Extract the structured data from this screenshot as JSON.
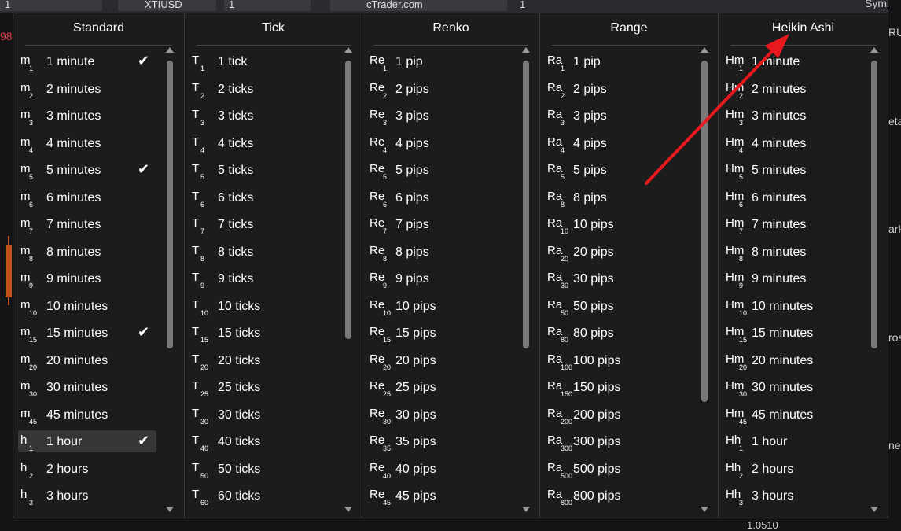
{
  "background": {
    "tabs": [
      "1",
      "XTIUSD",
      "1",
      "cTrader.com",
      "1"
    ],
    "symbol_label": "Symb",
    "right_fragments": [
      "RU",
      "eta",
      "ark",
      "ros",
      "ne"
    ],
    "left_fragment": "98",
    "price_label": "1.0510"
  },
  "colors": {
    "panel_bg": "#1c1c1c",
    "text": "#ffffff",
    "selected_row": "#363638",
    "arrow": "#e8191e",
    "candle": "#c0541e"
  },
  "columns": [
    {
      "title": "Standard",
      "rows": [
        {
          "abbr": "m",
          "sub": "1",
          "label": "1 minute",
          "checked": true
        },
        {
          "abbr": "m",
          "sub": "2",
          "label": "2 minutes",
          "checked": false
        },
        {
          "abbr": "m",
          "sub": "3",
          "label": "3 minutes",
          "checked": false
        },
        {
          "abbr": "m",
          "sub": "4",
          "label": "4 minutes",
          "checked": false
        },
        {
          "abbr": "m",
          "sub": "5",
          "label": "5 minutes",
          "checked": true
        },
        {
          "abbr": "m",
          "sub": "6",
          "label": "6 minutes",
          "checked": false
        },
        {
          "abbr": "m",
          "sub": "7",
          "label": "7 minutes",
          "checked": false
        },
        {
          "abbr": "m",
          "sub": "8",
          "label": "8 minutes",
          "checked": false
        },
        {
          "abbr": "m",
          "sub": "9",
          "label": "9 minutes",
          "checked": false
        },
        {
          "abbr": "m",
          "sub": "10",
          "label": "10 minutes",
          "checked": false
        },
        {
          "abbr": "m",
          "sub": "15",
          "label": "15 minutes",
          "checked": true
        },
        {
          "abbr": "m",
          "sub": "20",
          "label": "20 minutes",
          "checked": false
        },
        {
          "abbr": "m",
          "sub": "30",
          "label": "30 minutes",
          "checked": false
        },
        {
          "abbr": "m",
          "sub": "45",
          "label": "45 minutes",
          "checked": false
        },
        {
          "abbr": "h",
          "sub": "1",
          "label": "1 hour",
          "checked": true,
          "selected": true
        },
        {
          "abbr": "h",
          "sub": "2",
          "label": "2 hours",
          "checked": false
        },
        {
          "abbr": "h",
          "sub": "3",
          "label": "3 hours",
          "checked": false
        }
      ]
    },
    {
      "title": "Tick",
      "rows": [
        {
          "abbr": "T",
          "sub": "1",
          "label": "1 tick"
        },
        {
          "abbr": "T",
          "sub": "2",
          "label": "2 ticks"
        },
        {
          "abbr": "T",
          "sub": "3",
          "label": "3 ticks"
        },
        {
          "abbr": "T",
          "sub": "4",
          "label": "4 ticks"
        },
        {
          "abbr": "T",
          "sub": "5",
          "label": "5 ticks"
        },
        {
          "abbr": "T",
          "sub": "6",
          "label": "6 ticks"
        },
        {
          "abbr": "T",
          "sub": "7",
          "label": "7 ticks"
        },
        {
          "abbr": "T",
          "sub": "8",
          "label": "8 ticks"
        },
        {
          "abbr": "T",
          "sub": "9",
          "label": "9 ticks"
        },
        {
          "abbr": "T",
          "sub": "10",
          "label": "10 ticks"
        },
        {
          "abbr": "T",
          "sub": "15",
          "label": "15 ticks"
        },
        {
          "abbr": "T",
          "sub": "20",
          "label": "20 ticks"
        },
        {
          "abbr": "T",
          "sub": "25",
          "label": "25 ticks"
        },
        {
          "abbr": "T",
          "sub": "30",
          "label": "30 ticks"
        },
        {
          "abbr": "T",
          "sub": "40",
          "label": "40 ticks"
        },
        {
          "abbr": "T",
          "sub": "50",
          "label": "50 ticks"
        },
        {
          "abbr": "T",
          "sub": "60",
          "label": "60 ticks"
        }
      ]
    },
    {
      "title": "Renko",
      "rows": [
        {
          "abbr": "Re",
          "sub": "1",
          "label": "1 pip"
        },
        {
          "abbr": "Re",
          "sub": "2",
          "label": "2 pips"
        },
        {
          "abbr": "Re",
          "sub": "3",
          "label": "3 pips"
        },
        {
          "abbr": "Re",
          "sub": "4",
          "label": "4 pips"
        },
        {
          "abbr": "Re",
          "sub": "5",
          "label": "5 pips"
        },
        {
          "abbr": "Re",
          "sub": "6",
          "label": "6 pips"
        },
        {
          "abbr": "Re",
          "sub": "7",
          "label": "7 pips"
        },
        {
          "abbr": "Re",
          "sub": "8",
          "label": "8 pips"
        },
        {
          "abbr": "Re",
          "sub": "9",
          "label": "9 pips"
        },
        {
          "abbr": "Re",
          "sub": "10",
          "label": "10 pips"
        },
        {
          "abbr": "Re",
          "sub": "15",
          "label": "15 pips"
        },
        {
          "abbr": "Re",
          "sub": "20",
          "label": "20 pips"
        },
        {
          "abbr": "Re",
          "sub": "25",
          "label": "25 pips"
        },
        {
          "abbr": "Re",
          "sub": "30",
          "label": "30 pips"
        },
        {
          "abbr": "Re",
          "sub": "35",
          "label": "35 pips"
        },
        {
          "abbr": "Re",
          "sub": "40",
          "label": "40 pips"
        },
        {
          "abbr": "Re",
          "sub": "45",
          "label": "45 pips"
        }
      ]
    },
    {
      "title": "Range",
      "rows": [
        {
          "abbr": "Ra",
          "sub": "1",
          "label": "1 pip"
        },
        {
          "abbr": "Ra",
          "sub": "2",
          "label": "2 pips"
        },
        {
          "abbr": "Ra",
          "sub": "3",
          "label": "3 pips"
        },
        {
          "abbr": "Ra",
          "sub": "4",
          "label": "4 pips"
        },
        {
          "abbr": "Ra",
          "sub": "5",
          "label": "5 pips"
        },
        {
          "abbr": "Ra",
          "sub": "8",
          "label": "8 pips"
        },
        {
          "abbr": "Ra",
          "sub": "10",
          "label": "10 pips"
        },
        {
          "abbr": "Ra",
          "sub": "20",
          "label": "20 pips"
        },
        {
          "abbr": "Ra",
          "sub": "30",
          "label": "30 pips"
        },
        {
          "abbr": "Ra",
          "sub": "50",
          "label": "50 pips"
        },
        {
          "abbr": "Ra",
          "sub": "80",
          "label": "80 pips"
        },
        {
          "abbr": "Ra",
          "sub": "100",
          "label": "100 pips"
        },
        {
          "abbr": "Ra",
          "sub": "150",
          "label": "150 pips"
        },
        {
          "abbr": "Ra",
          "sub": "200",
          "label": "200 pips"
        },
        {
          "abbr": "Ra",
          "sub": "300",
          "label": "300 pips"
        },
        {
          "abbr": "Ra",
          "sub": "500",
          "label": "500 pips"
        },
        {
          "abbr": "Ra",
          "sub": "800",
          "label": "800 pips"
        }
      ]
    },
    {
      "title": "Heikin Ashi",
      "rows": [
        {
          "abbr": "Hm",
          "sub": "1",
          "label": "1 minute"
        },
        {
          "abbr": "Hm",
          "sub": "2",
          "label": "2 minutes"
        },
        {
          "abbr": "Hm",
          "sub": "3",
          "label": "3 minutes"
        },
        {
          "abbr": "Hm",
          "sub": "4",
          "label": "4 minutes"
        },
        {
          "abbr": "Hm",
          "sub": "5",
          "label": "5 minutes"
        },
        {
          "abbr": "Hm",
          "sub": "6",
          "label": "6 minutes"
        },
        {
          "abbr": "Hm",
          "sub": "7",
          "label": "7 minutes"
        },
        {
          "abbr": "Hm",
          "sub": "8",
          "label": "8 minutes"
        },
        {
          "abbr": "Hm",
          "sub": "9",
          "label": "9 minutes"
        },
        {
          "abbr": "Hm",
          "sub": "10",
          "label": "10 minutes"
        },
        {
          "abbr": "Hm",
          "sub": "15",
          "label": "15 minutes"
        },
        {
          "abbr": "Hm",
          "sub": "20",
          "label": "20 minutes"
        },
        {
          "abbr": "Hm",
          "sub": "30",
          "label": "30 minutes"
        },
        {
          "abbr": "Hm",
          "sub": "45",
          "label": "45 minutes"
        },
        {
          "abbr": "Hh",
          "sub": "1",
          "label": "1 hour"
        },
        {
          "abbr": "Hh",
          "sub": "2",
          "label": "2 hours"
        },
        {
          "abbr": "Hh",
          "sub": "3",
          "label": "3 hours"
        }
      ]
    }
  ]
}
